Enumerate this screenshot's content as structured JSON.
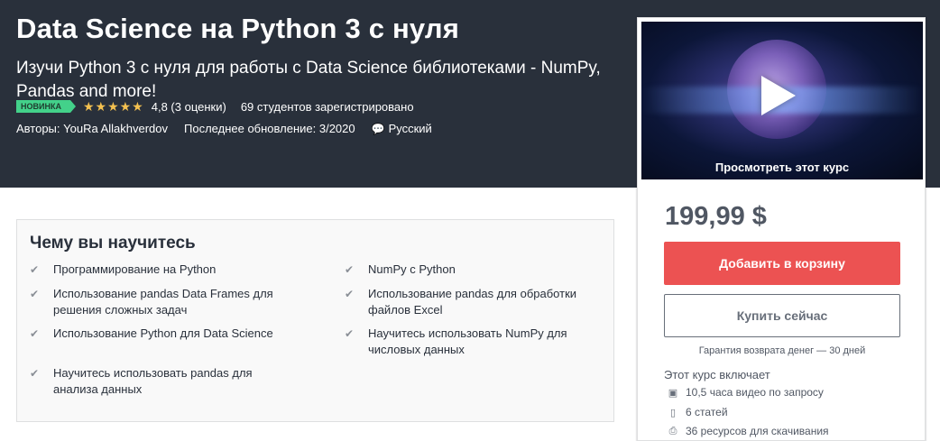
{
  "course": {
    "title": "Data Science на Python 3 с нуля",
    "subtitle": "Изучи Python 3 с нуля для работы с Data Science библиотеками - NumPy, Pandas and more!",
    "badge": "НОВИНКА",
    "stars": "★★★★★",
    "rating": "4,8 (3 оценки)",
    "students": "69 студентов зарегистрировано",
    "authors": "Авторы: YouRa Allakhverdov",
    "updated": "Последнее обновление: 3/2020",
    "language": "Русский"
  },
  "sidebar": {
    "preview_label": "Просмотреть этот курс",
    "price": "199,99 $",
    "add_to_cart": "Добавить в корзину",
    "buy_now": "Купить сейчас",
    "guarantee": "Гарантия возврата денег — 30 дней",
    "includes_title": "Этот курс включает",
    "includes": [
      {
        "icon": "video-icon",
        "text": "10,5 часа видео по запросу"
      },
      {
        "icon": "file-icon",
        "text": "6 статей"
      },
      {
        "icon": "download-icon",
        "text": "36 ресурсов для скачивания"
      }
    ]
  },
  "learn": {
    "title": "Чему вы научитесь",
    "items": [
      "Программирование на Python",
      "NumPy с Python",
      "Использование pandas Data Frames для решения сложных задач",
      "Использование pandas для обработки файлов Excel",
      "Использование Python для Data Science",
      "Научитесь использовать NumPy для числовых данных",
      "Научитесь использовать pandas для анализа данных"
    ]
  },
  "colors": {
    "hero_bg": "#29303b",
    "accent": "#ec5252",
    "badge": "#43d18a",
    "stars": "#f4c150"
  }
}
